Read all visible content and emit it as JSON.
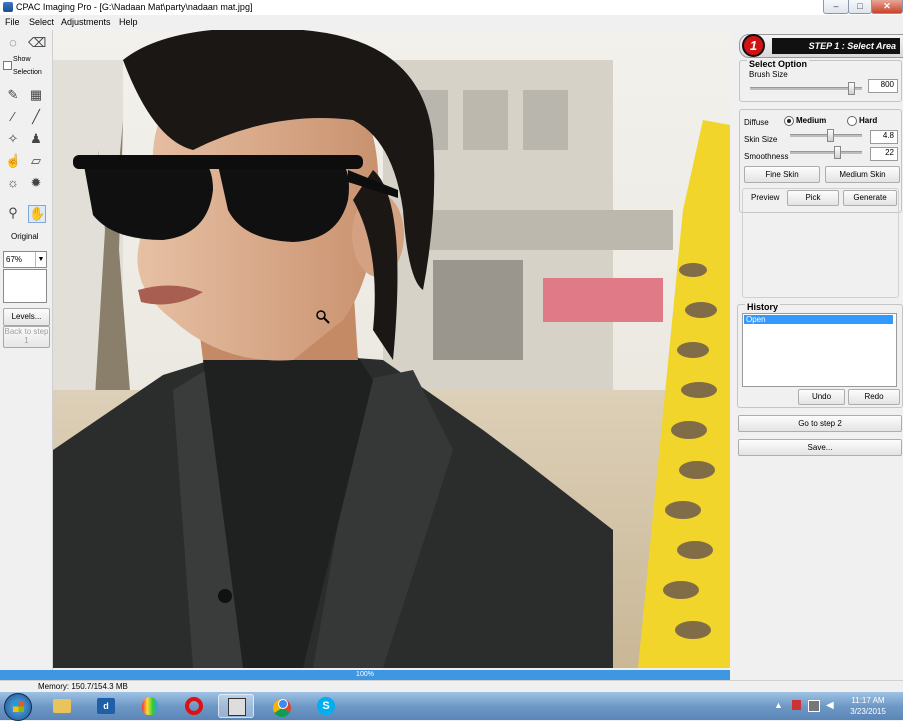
{
  "window": {
    "title": "CPAC Imaging Pro - [G:\\Nadaan Mat\\party\\nadaan mat.jpg]",
    "buttons": {
      "minimize": "–",
      "maximize": "□",
      "close": "✕"
    }
  },
  "menu": [
    "File",
    "Select",
    "Adjustments",
    "Help"
  ],
  "toolbox": {
    "show_label": "Show",
    "selection_label": "Selection",
    "original_label": "Original",
    "zoom_value": "67%",
    "levels_label": "Levels...",
    "back_label": "Back to step 1"
  },
  "step": {
    "number": "1",
    "title": "STEP 1 : Select Area"
  },
  "select_option": {
    "title": "Select Option",
    "brush_label": "Brush Size",
    "brush_value": "800",
    "brush_level": 0.9
  },
  "diffuse": {
    "label": "Diffuse",
    "options": [
      "Medium",
      "Hard"
    ],
    "selected": "Medium",
    "skin_size_label": "Skin Size",
    "skin_size_value": "4.8",
    "skin_size_level": 0.55,
    "smoothness_label": "Smoothness",
    "smoothness_value": "22",
    "smoothness_level": 0.65,
    "fine_skin_label": "Fine Skin",
    "medium_skin_label": "Medium Skin"
  },
  "preview": {
    "label": "Preview",
    "pick_label": "Pick",
    "generate_label": "Generate"
  },
  "history": {
    "title": "History",
    "items": [
      "Open"
    ],
    "undo_label": "Undo",
    "redo_label": "Redo"
  },
  "actions": {
    "goto_step2": "Go to step 2",
    "save": "Save..."
  },
  "progress": {
    "text": "100%",
    "value": 1.0
  },
  "status": {
    "memory": "Memory: 150.7/154.3 MB"
  },
  "clock": {
    "time": "11:17 AM",
    "date": "3/23/2015"
  },
  "colors": {
    "accent": "#3f97e2",
    "step_badge": "#d01414",
    "history_selected": "#3399ff"
  }
}
